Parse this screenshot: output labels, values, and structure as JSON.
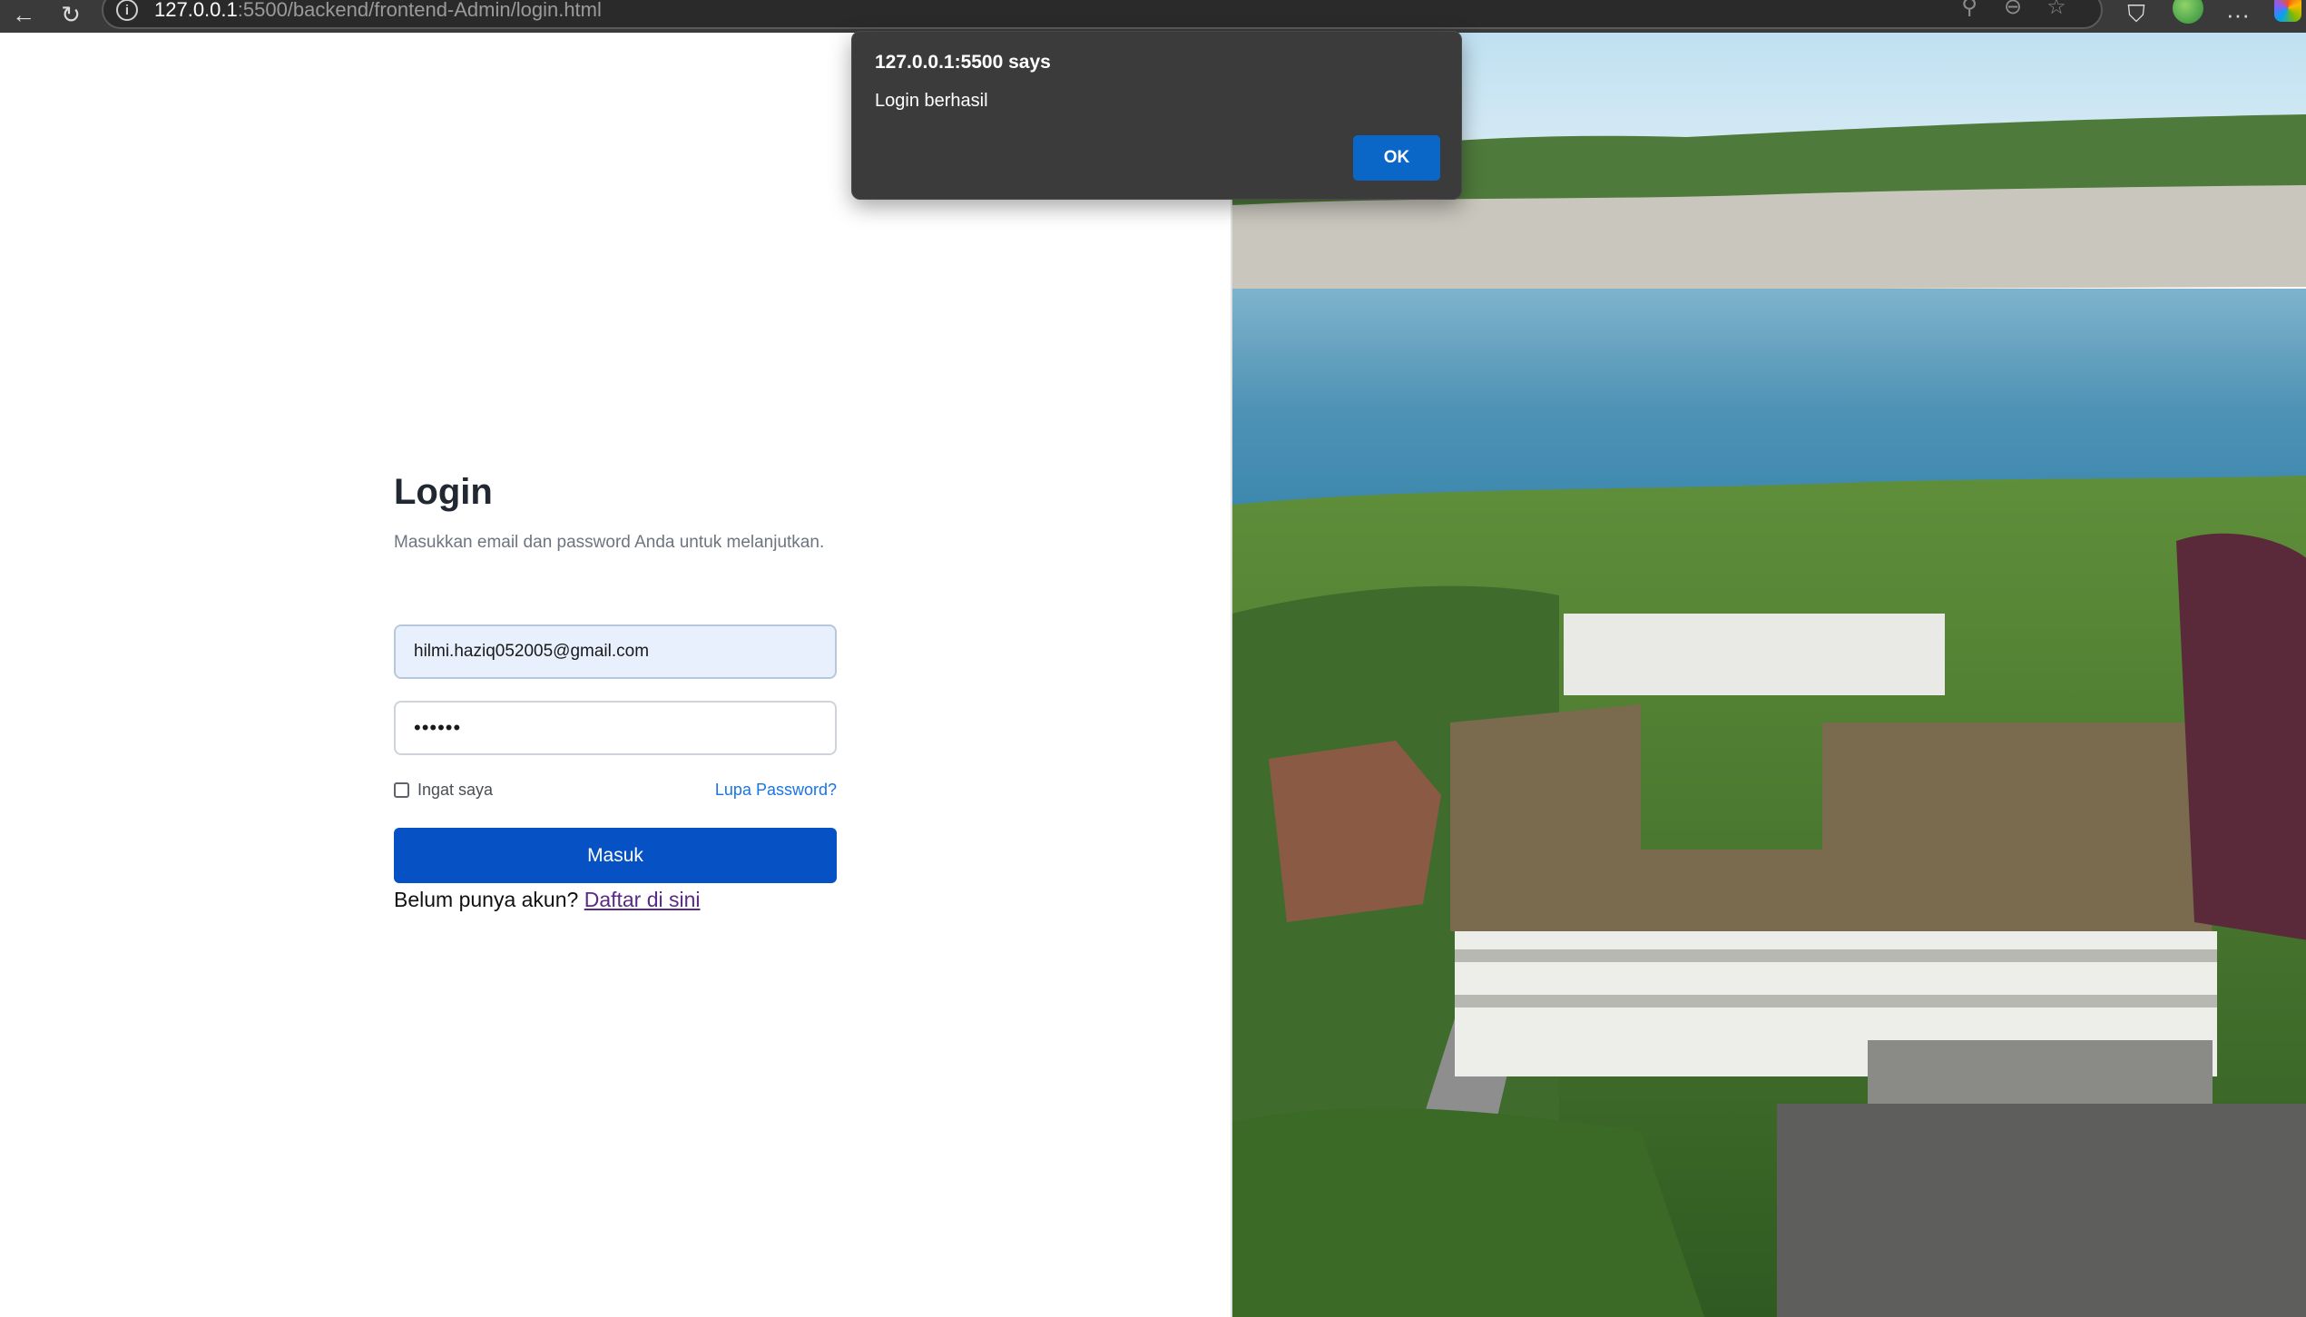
{
  "browser": {
    "url_host": "127.0.0.1",
    "url_path": ":5500/backend/frontend-Admin/login.html",
    "icons": {
      "back": "back-arrow-icon",
      "reload": "reload-icon",
      "info": "info-icon",
      "read_aloud": "read-aloud-icon",
      "zoom": "zoom-icon",
      "favorite": "star-icon",
      "shield": "shield-icon",
      "profile": "avatar",
      "menu": "more-icon",
      "copilot": "copilot-icon"
    },
    "glyphs": {
      "back": "←",
      "reload": "↻",
      "info": "i",
      "read_aloud": "⚲",
      "zoom": "⊖",
      "favorite": "☆",
      "shield": "⛉",
      "menu": "···"
    }
  },
  "login": {
    "title": "Login",
    "subtitle": "Masukkan email dan password Anda untuk melanjutkan.",
    "email_value": "hilmi.haziq052005@gmail.com",
    "password_value": "••••••",
    "remember_label": "Ingat saya",
    "forgot_label": "Lupa Password?",
    "submit_label": "Masuk",
    "register_prompt": "Belum punya akun?",
    "register_link": "Daftar di sini"
  },
  "alert": {
    "title": "127.0.0.1:5500 says",
    "message": "Login berhasil",
    "ok_label": "OK"
  },
  "colors": {
    "primary_button": "#0652c5",
    "link": "#1a73e8",
    "visited_link": "#5b2a86",
    "autofill_bg": "#e8f0fe",
    "dialog_bg": "#3b3b3b",
    "dialog_button": "#0b67c7"
  }
}
